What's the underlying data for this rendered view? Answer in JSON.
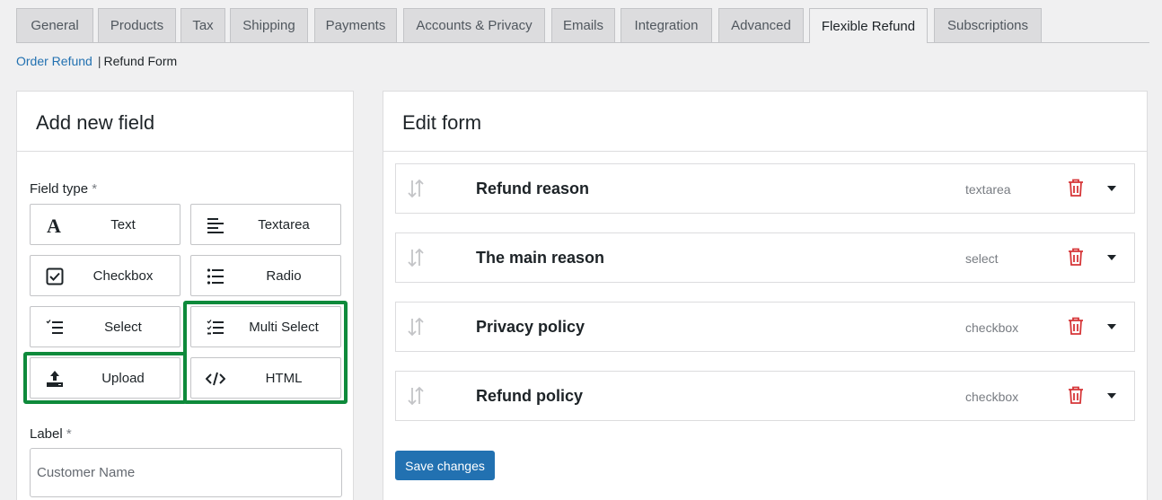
{
  "tabs": [
    {
      "label": "General"
    },
    {
      "label": "Products"
    },
    {
      "label": "Tax"
    },
    {
      "label": "Shipping"
    },
    {
      "label": "Payments"
    },
    {
      "label": "Accounts & Privacy"
    },
    {
      "label": "Emails"
    },
    {
      "label": "Integration"
    },
    {
      "label": "Advanced"
    },
    {
      "label": "Flexible Refund",
      "active": true
    },
    {
      "label": "Subscriptions"
    }
  ],
  "breadcrumb": {
    "link": "Order Refund",
    "separator": "|",
    "current": "Refund Form"
  },
  "add_field": {
    "title": "Add new field",
    "field_type_label": "Field type",
    "required_mark": "*",
    "types": [
      {
        "label": "Text",
        "icon": "text-icon"
      },
      {
        "label": "Textarea",
        "icon": "textarea-icon"
      },
      {
        "label": "Checkbox",
        "icon": "checkbox-icon"
      },
      {
        "label": "Radio",
        "icon": "radio-list-icon"
      },
      {
        "label": "Select",
        "icon": "select-icon"
      },
      {
        "label": "Multi Select",
        "icon": "multi-select-icon"
      },
      {
        "label": "Upload",
        "icon": "upload-icon"
      },
      {
        "label": "HTML",
        "icon": "code-icon"
      }
    ],
    "label_label": "Label",
    "label_placeholder": "Customer Name"
  },
  "edit_form": {
    "title": "Edit form",
    "fields": [
      {
        "name": "Refund reason",
        "type": "textarea"
      },
      {
        "name": "The main reason",
        "type": "select"
      },
      {
        "name": "Privacy policy",
        "type": "checkbox"
      },
      {
        "name": "Refund policy",
        "type": "checkbox"
      }
    ],
    "save_label": "Save changes"
  },
  "colors": {
    "accent": "#2271b1",
    "highlight": "#0e8a3b",
    "danger": "#d63638"
  }
}
